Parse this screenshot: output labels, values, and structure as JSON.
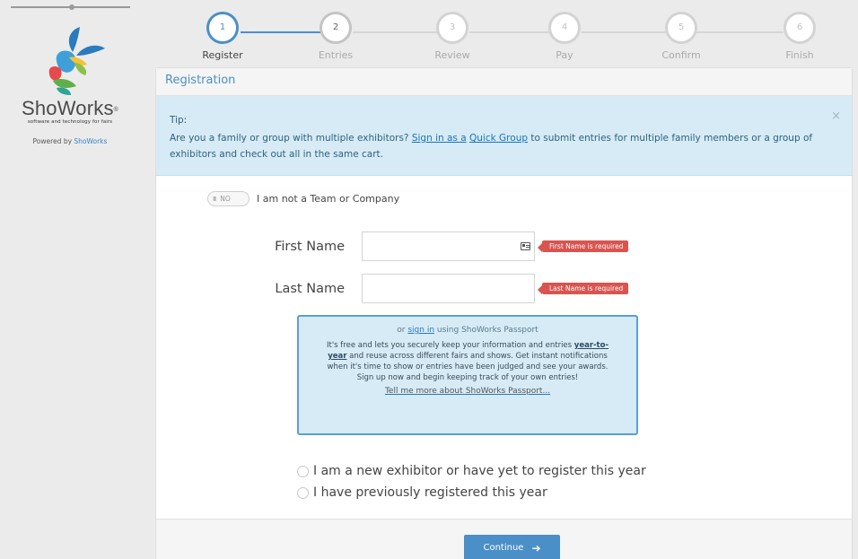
{
  "brand": {
    "name": "ShoWorks",
    "trademark": "®",
    "tagline": "software and technology for fairs",
    "powered_prefix": "Powered by",
    "powered_link": "ShoWorks"
  },
  "steps": [
    {
      "num": "1",
      "label": "Register",
      "state": "active"
    },
    {
      "num": "2",
      "label": "Entries",
      "state": "next"
    },
    {
      "num": "3",
      "label": "Review",
      "state": "pending"
    },
    {
      "num": "4",
      "label": "Pay",
      "state": "pending"
    },
    {
      "num": "5",
      "label": "Confirm",
      "state": "pending"
    },
    {
      "num": "6",
      "label": "Finish",
      "state": "pending"
    }
  ],
  "panel": {
    "title": "Registration"
  },
  "tip": {
    "title": "Tip:",
    "text_a": "Are you a family or group with multiple exhibitors?",
    "link_a": "Sign in as a",
    "link_b": "Quick Group",
    "text_b": "to submit entries for multiple family members or a group of exhibitors and check out all in the same cart.",
    "close": "×"
  },
  "team_toggle": {
    "grip": "III",
    "state": "NO",
    "label": "I am not a Team or Company"
  },
  "form": {
    "first_name_label": "First Name",
    "first_name_value": "",
    "first_name_error": "First Name is required",
    "last_name_label": "Last Name",
    "last_name_value": "",
    "last_name_error": "Last Name is required"
  },
  "passport": {
    "or_text": "or",
    "signin_link": "sign in",
    "using_text": "using ShoWorks Passport",
    "body_a": "It's free and lets you securely keep your information and entries",
    "body_u": "year-to-year",
    "body_b": "and reuse across different fairs and shows. Get instant notifications when it's time to show or entries have been judged and see your awards. Sign up now and begin keeping track of your own entries!",
    "more_link": "Tell me more about",
    "more_suffix": "ShoWorks Passport..."
  },
  "options": {
    "new_exhibitor": "I am a new exhibitor or have yet to register this year",
    "previously_registered": "I have previously registered this year"
  },
  "actions": {
    "continue": "Continue",
    "continue_arrow": "➔"
  },
  "colors": {
    "accent": "#4b8fc9",
    "tip_bg": "#d6ebf5",
    "error": "#d9544f"
  }
}
